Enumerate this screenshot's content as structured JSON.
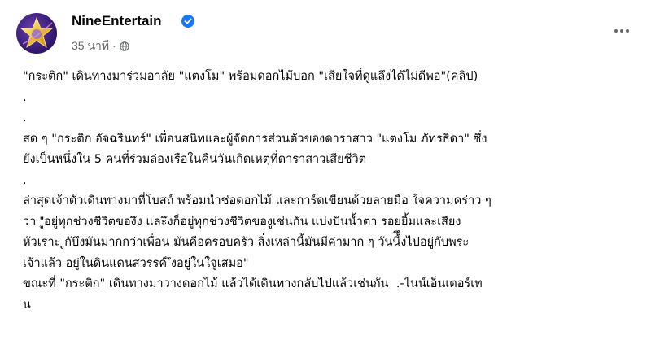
{
  "post": {
    "author": "NineEntertain",
    "verified": true,
    "time": "35 นาที",
    "privacy_icon": "globe-icon",
    "more_icon": "more-options-icon",
    "lines": [
      "\"กระติก\" เดินทางมาร่วมอาลัย \"แตงโม\" พร้อมดอกไม้บอก \"เสียใจที่ดูแลึงได้ไม่ดีพอ\"(คลิป)",
      ".",
      ".",
      "สด ๆ \"กระติก อัจฉรินทร์\" เพื่อนสนิทและผู้จัดการส่วนตัวของดาราสาว \"แตงโม ภัทรธิดา\" ซึ่ง",
      "ยังเป็นหนึ่งใน 5 คนที่ร่วมล่องเรือในคืนวันเกิดเหตุที่ดาราสาวเสียชีวิต",
      ".",
      "ล่าสุดเจ้าตัวเดินทางมาที่โบสถ์ พร้อมนำช่อดอกไม้ และการ์ดเขียนด้วยลายมือ ใจความคร่าว ๆ",
      "ว่า \"ูอยู่ทุกช่วงชีวิตของึง และึงก็อยู่ทุกช่วงชีวิตของูเช่นกัน แบ่งปันน้ำตา รอยยิ้มและเสียง",
      "หัวเราะ ูกับึงมันมากกว่าเพื่อน มันคือครอบครัว สิ่งเหล่านี้มันมีค่ามาก ๆ วันนี้ึงไปอยู่กับพระ",
      "เจ้าแล้ว อยู่ในดินแดนสวรรค์ ึงอยู่ในใจูเสมอ\"",
      "ขณะที่ \"กระติก\" เดินทางมาวางดอกไม้ แล้วได้เดินทางกลับไปแล้วเช่นกัน  .-ไนน์เอ็นเตอร์เท",
      "น"
    ]
  },
  "colors": {
    "verified_blue": "#1877f2",
    "secondary_text": "#65676b",
    "avatar_purple": "#4a2a8f",
    "star_gold": "#f2c230"
  }
}
